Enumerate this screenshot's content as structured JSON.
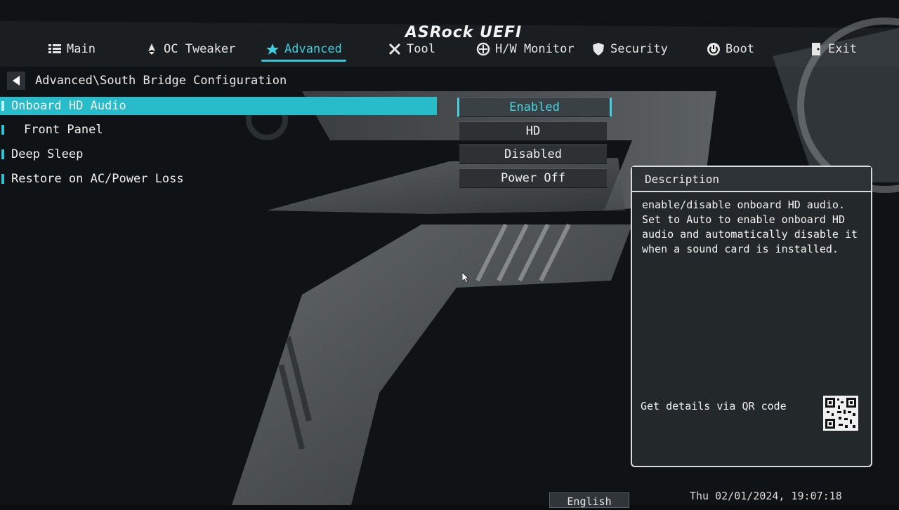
{
  "header": {
    "brand": "ASRock UEFI",
    "tabs": [
      {
        "label": "Main",
        "icon": "list-icon"
      },
      {
        "label": "OC Tweaker",
        "icon": "rocket-icon"
      },
      {
        "label": "Advanced",
        "icon": "star-icon",
        "active": true
      },
      {
        "label": "Tool",
        "icon": "wrench-icon"
      },
      {
        "label": "H/W Monitor",
        "icon": "monitor-icon"
      },
      {
        "label": "Security",
        "icon": "shield-icon"
      },
      {
        "label": "Boot",
        "icon": "power-icon"
      },
      {
        "label": "Exit",
        "icon": "exit-icon"
      }
    ]
  },
  "breadcrumb": "Advanced\\South Bridge Configuration",
  "settings": [
    {
      "label": "Onboard HD Audio",
      "value": "Enabled"
    },
    {
      "label": "Front Panel",
      "value": "HD"
    },
    {
      "label": "Deep Sleep",
      "value": "Disabled"
    },
    {
      "label": "Restore on AC/Power Loss",
      "value": "Power Off"
    }
  ],
  "description": {
    "title": "Description",
    "text": "enable/disable onboard HD audio. Set to Auto to enable onboard HD audio and automatically disable it when a sound card is installed.",
    "qr_label": "Get details via QR code"
  },
  "footer": {
    "language": "English",
    "datetime": "Thu 02/01/2024, 19:07:18"
  },
  "colors": {
    "accent": "#28bccb",
    "panel": "#23282b",
    "background": "#0b0d0e"
  }
}
